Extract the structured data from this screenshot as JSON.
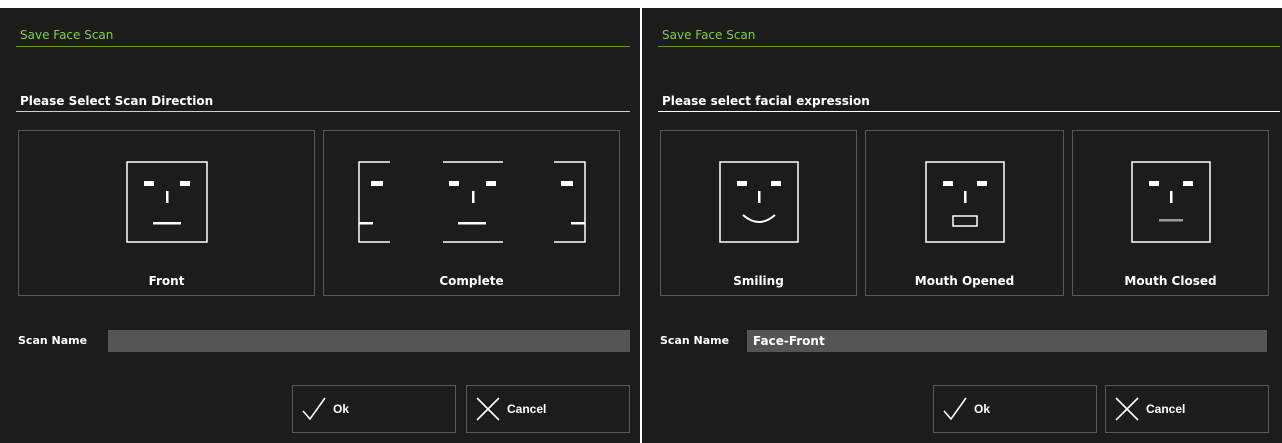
{
  "left": {
    "title": "Save Face Scan",
    "section": "Please Select Scan Direction",
    "options": [
      {
        "label": "Front",
        "icon": "face-front-icon"
      },
      {
        "label": "Complete",
        "icon": "face-complete-icon"
      }
    ],
    "scan_name_label": "Scan Name",
    "scan_name_value": "",
    "ok_label": "Ok",
    "cancel_label": "Cancel"
  },
  "right": {
    "title": "Save Face Scan",
    "section": "Please select facial expression",
    "options": [
      {
        "label": "Smiling",
        "icon": "face-smiling-icon"
      },
      {
        "label": "Mouth Opened",
        "icon": "face-mouth-opened-icon"
      },
      {
        "label": "Mouth Closed",
        "icon": "face-mouth-closed-icon"
      }
    ],
    "scan_name_label": "Scan Name",
    "scan_name_value": "Face-Front",
    "ok_label": "Ok",
    "cancel_label": "Cancel"
  },
  "colors": {
    "panel_bg": "#1c1c1c",
    "title_green": "#7fd04a",
    "input_bg": "#555555",
    "border": "#585858"
  }
}
